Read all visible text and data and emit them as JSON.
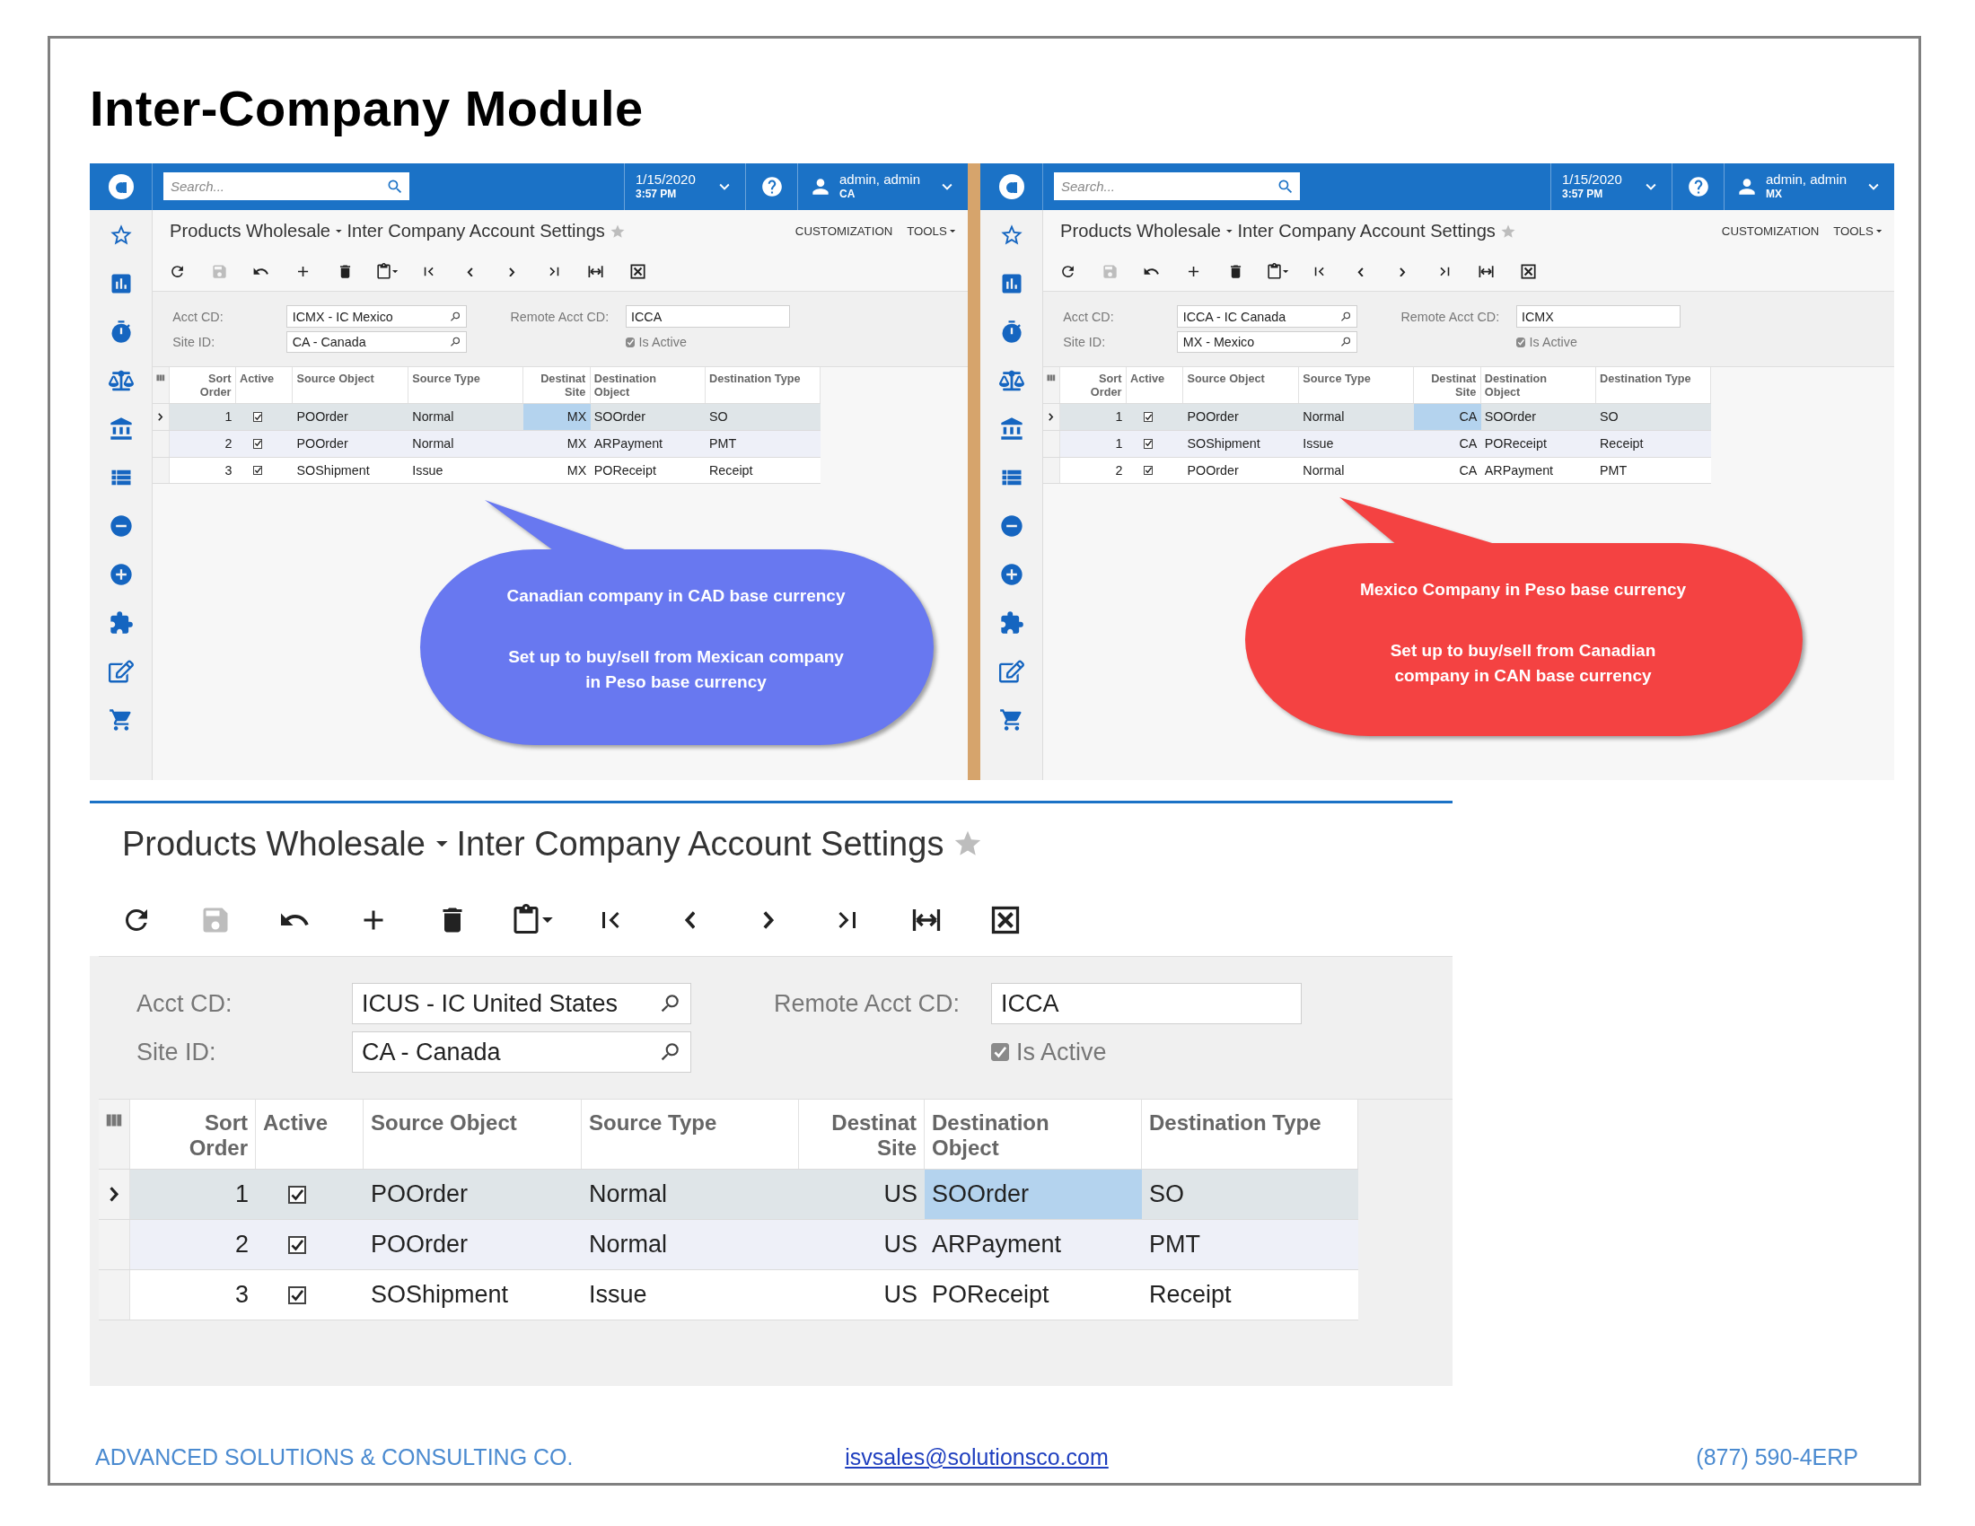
{
  "title": "Inter-Company Module",
  "screens": [
    {
      "search": {
        "placeholder": "Search..."
      },
      "date": "1/15/2020",
      "time": "3:57 PM",
      "user": "admin, admin",
      "branch": "CA",
      "breadcrumb": {
        "company": "Products Wholesale",
        "screen": "Inter Company Account Settings"
      },
      "menu": [
        {
          "label": "CUSTOMIZATION",
          "dropdown": false
        },
        {
          "label": "TOOLS",
          "dropdown": true
        }
      ],
      "toolbar": [
        {
          "kind": "refresh",
          "disabled": false
        },
        {
          "kind": "save",
          "disabled": true
        },
        {
          "kind": "undo",
          "disabled": false
        },
        {
          "kind": "add",
          "disabled": false
        },
        {
          "kind": "delete",
          "disabled": false
        },
        {
          "kind": "paste",
          "disabled": false
        },
        {
          "kind": "first",
          "disabled": false
        },
        {
          "kind": "prev",
          "disabled": false
        },
        {
          "kind": "next",
          "disabled": false
        },
        {
          "kind": "last",
          "disabled": false
        },
        {
          "kind": "fit",
          "disabled": false
        },
        {
          "kind": "export",
          "disabled": false
        }
      ],
      "form": {
        "acct_label": "Acct CD:",
        "acct_value": "ICMX - IC Mexico",
        "site_label": "Site ID:",
        "site_value": "CA - Canada",
        "remote_label": "Remote Acct CD:",
        "remote_value": "ICCA",
        "active_label": "Is Active",
        "is_active": true
      },
      "grid": {
        "columns": [
          {
            "label": "Sort\nOrder"
          },
          {
            "label": "Active"
          },
          {
            "label": "Source Object"
          },
          {
            "label": "Source Type"
          },
          {
            "label": "Destinat\nSite"
          },
          {
            "label": "Destination\nObject"
          },
          {
            "label": "Destination Type"
          }
        ],
        "rows": [
          {
            "selected": true,
            "cells": [
              {
                "kind": "text",
                "text": "1",
                "focused": false
              },
              {
                "kind": "checkbox",
                "checked": true
              },
              {
                "kind": "text",
                "text": "POOrder",
                "focused": false
              },
              {
                "kind": "text",
                "text": "Normal",
                "focused": false
              },
              {
                "kind": "text",
                "text": "MX",
                "focused": true
              },
              {
                "kind": "text",
                "text": "SOOrder",
                "focused": false
              },
              {
                "kind": "text",
                "text": "SO",
                "focused": false
              }
            ]
          },
          {
            "selected": false,
            "cells": [
              {
                "kind": "text",
                "text": "2",
                "focused": false
              },
              {
                "kind": "checkbox",
                "checked": true
              },
              {
                "kind": "text",
                "text": "POOrder",
                "focused": false
              },
              {
                "kind": "text",
                "text": "Normal",
                "focused": false
              },
              {
                "kind": "text",
                "text": "MX",
                "focused": false
              },
              {
                "kind": "text",
                "text": "ARPayment",
                "focused": false
              },
              {
                "kind": "text",
                "text": "PMT",
                "focused": false
              }
            ]
          },
          {
            "selected": false,
            "cells": [
              {
                "kind": "text",
                "text": "3",
                "focused": false
              },
              {
                "kind": "checkbox",
                "checked": true
              },
              {
                "kind": "text",
                "text": "SOShipment",
                "focused": false
              },
              {
                "kind": "text",
                "text": "Issue",
                "focused": false
              },
              {
                "kind": "text",
                "text": "MX",
                "focused": false
              },
              {
                "kind": "text",
                "text": "POReceipt",
                "focused": false
              },
              {
                "kind": "text",
                "text": "Receipt",
                "focused": false
              }
            ]
          }
        ]
      },
      "callout": {
        "color": "#6878f0",
        "title": "Canadian company in CAD base currency",
        "text": "Set up to buy/sell from Mexican company in Peso base currency"
      }
    },
    {
      "search": {
        "placeholder": "Search..."
      },
      "date": "1/15/2020",
      "time": "3:57 PM",
      "user": "admin, admin",
      "branch": "MX",
      "breadcrumb": {
        "company": "Products Wholesale",
        "screen": "Inter Company Account Settings"
      },
      "menu": [
        {
          "label": "CUSTOMIZATION",
          "dropdown": false
        },
        {
          "label": "TOOLS",
          "dropdown": true
        }
      ],
      "toolbar": [
        {
          "kind": "refresh",
          "disabled": false
        },
        {
          "kind": "save",
          "disabled": true
        },
        {
          "kind": "undo",
          "disabled": false
        },
        {
          "kind": "add",
          "disabled": false
        },
        {
          "kind": "delete",
          "disabled": false
        },
        {
          "kind": "paste",
          "disabled": false
        },
        {
          "kind": "first",
          "disabled": false
        },
        {
          "kind": "prev",
          "disabled": false
        },
        {
          "kind": "next",
          "disabled": false
        },
        {
          "kind": "last",
          "disabled": false
        },
        {
          "kind": "fit",
          "disabled": false
        },
        {
          "kind": "export",
          "disabled": false
        }
      ],
      "form": {
        "acct_label": "Acct CD:",
        "acct_value": "ICCA - IC Canada",
        "site_label": "Site ID:",
        "site_value": "MX - Mexico",
        "remote_label": "Remote Acct CD:",
        "remote_value": "ICMX",
        "active_label": "Is Active",
        "is_active": true
      },
      "grid": {
        "columns": [
          {
            "label": "Sort\nOrder"
          },
          {
            "label": "Active"
          },
          {
            "label": "Source Object"
          },
          {
            "label": "Source Type"
          },
          {
            "label": "Destinat\nSite"
          },
          {
            "label": "Destination\nObject"
          },
          {
            "label": "Destination Type"
          }
        ],
        "rows": [
          {
            "selected": true,
            "cells": [
              {
                "kind": "text",
                "text": "1",
                "focused": false
              },
              {
                "kind": "checkbox",
                "checked": true
              },
              {
                "kind": "text",
                "text": "POOrder",
                "focused": false
              },
              {
                "kind": "text",
                "text": "Normal",
                "focused": false
              },
              {
                "kind": "text",
                "text": "CA",
                "focused": true
              },
              {
                "kind": "text",
                "text": "SOOrder",
                "focused": false
              },
              {
                "kind": "text",
                "text": "SO",
                "focused": false
              }
            ]
          },
          {
            "selected": false,
            "cells": [
              {
                "kind": "text",
                "text": "1",
                "focused": false
              },
              {
                "kind": "checkbox",
                "checked": true
              },
              {
                "kind": "text",
                "text": "SOShipment",
                "focused": false
              },
              {
                "kind": "text",
                "text": "Issue",
                "focused": false
              },
              {
                "kind": "text",
                "text": "CA",
                "focused": false
              },
              {
                "kind": "text",
                "text": "POReceipt",
                "focused": false
              },
              {
                "kind": "text",
                "text": "Receipt",
                "focused": false
              }
            ]
          },
          {
            "selected": false,
            "cells": [
              {
                "kind": "text",
                "text": "2",
                "focused": false
              },
              {
                "kind": "checkbox",
                "checked": true
              },
              {
                "kind": "text",
                "text": "POOrder",
                "focused": false
              },
              {
                "kind": "text",
                "text": "Normal",
                "focused": false
              },
              {
                "kind": "text",
                "text": "CA",
                "focused": false
              },
              {
                "kind": "text",
                "text": "ARPayment",
                "focused": false
              },
              {
                "kind": "text",
                "text": "PMT",
                "focused": false
              }
            ]
          }
        ]
      },
      "callout": {
        "color": "#f44242",
        "title": "Mexico Company in Peso base currency",
        "text": "Set up to buy/sell from Canadian company in CAN base currency"
      }
    }
  ],
  "detail": {
    "breadcrumb": {
      "company": "Products Wholesale",
      "screen": "Inter Company Account Settings"
    },
    "toolbar": [
      {
        "kind": "refresh",
        "disabled": false
      },
      {
        "kind": "save",
        "disabled": true
      },
      {
        "kind": "undo",
        "disabled": false
      },
      {
        "kind": "add",
        "disabled": false
      },
      {
        "kind": "delete",
        "disabled": false
      },
      {
        "kind": "paste",
        "disabled": false
      },
      {
        "kind": "first",
        "disabled": false
      },
      {
        "kind": "prev",
        "disabled": false
      },
      {
        "kind": "next",
        "disabled": false
      },
      {
        "kind": "last",
        "disabled": false
      },
      {
        "kind": "fit",
        "disabled": false
      },
      {
        "kind": "export",
        "disabled": false
      }
    ],
    "form": {
      "acct_label": "Acct CD:",
      "acct_value": "ICUS - IC United States",
      "site_label": "Site ID:",
      "site_value": "CA - Canada",
      "remote_label": "Remote Acct CD:",
      "remote_value": "ICCA",
      "active_label": "Is Active",
      "is_active": true
    },
    "grid": {
      "columns": [
        {
          "label": "Sort\nOrder"
        },
        {
          "label": "Active"
        },
        {
          "label": "Source Object"
        },
        {
          "label": "Source Type"
        },
        {
          "label": "Destinat\nSite"
        },
        {
          "label": "Destination\nObject"
        },
        {
          "label": "Destination Type"
        }
      ],
      "rows": [
        {
          "selected": true,
          "cells": [
            {
              "kind": "text",
              "text": "1",
              "focused": false
            },
            {
              "kind": "checkbox",
              "checked": true
            },
            {
              "kind": "text",
              "text": "POOrder",
              "focused": false
            },
            {
              "kind": "text",
              "text": "Normal",
              "focused": false
            },
            {
              "kind": "text",
              "text": "US",
              "focused": false
            },
            {
              "kind": "text",
              "text": "SOOrder",
              "focused": true
            },
            {
              "kind": "text",
              "text": "SO",
              "focused": false
            }
          ]
        },
        {
          "selected": false,
          "cells": [
            {
              "kind": "text",
              "text": "2",
              "focused": false
            },
            {
              "kind": "checkbox",
              "checked": true
            },
            {
              "kind": "text",
              "text": "POOrder",
              "focused": false
            },
            {
              "kind": "text",
              "text": "Normal",
              "focused": false
            },
            {
              "kind": "text",
              "text": "US",
              "focused": false
            },
            {
              "kind": "text",
              "text": "ARPayment",
              "focused": false
            },
            {
              "kind": "text",
              "text": "PMT",
              "focused": false
            }
          ]
        },
        {
          "selected": false,
          "cells": [
            {
              "kind": "text",
              "text": "3",
              "focused": false
            },
            {
              "kind": "checkbox",
              "checked": true
            },
            {
              "kind": "text",
              "text": "SOShipment",
              "focused": false
            },
            {
              "kind": "text",
              "text": "Issue",
              "focused": false
            },
            {
              "kind": "text",
              "text": "US",
              "focused": false
            },
            {
              "kind": "text",
              "text": "POReceipt",
              "focused": false
            },
            {
              "kind": "text",
              "text": "Receipt",
              "focused": false
            }
          ]
        }
      ]
    }
  },
  "footer": {
    "company": "ADVANCED SOLUTIONS & CONSULTING CO.",
    "email": "isvsales@solutionsco.com",
    "phone": "(877) 590-4ERP"
  }
}
